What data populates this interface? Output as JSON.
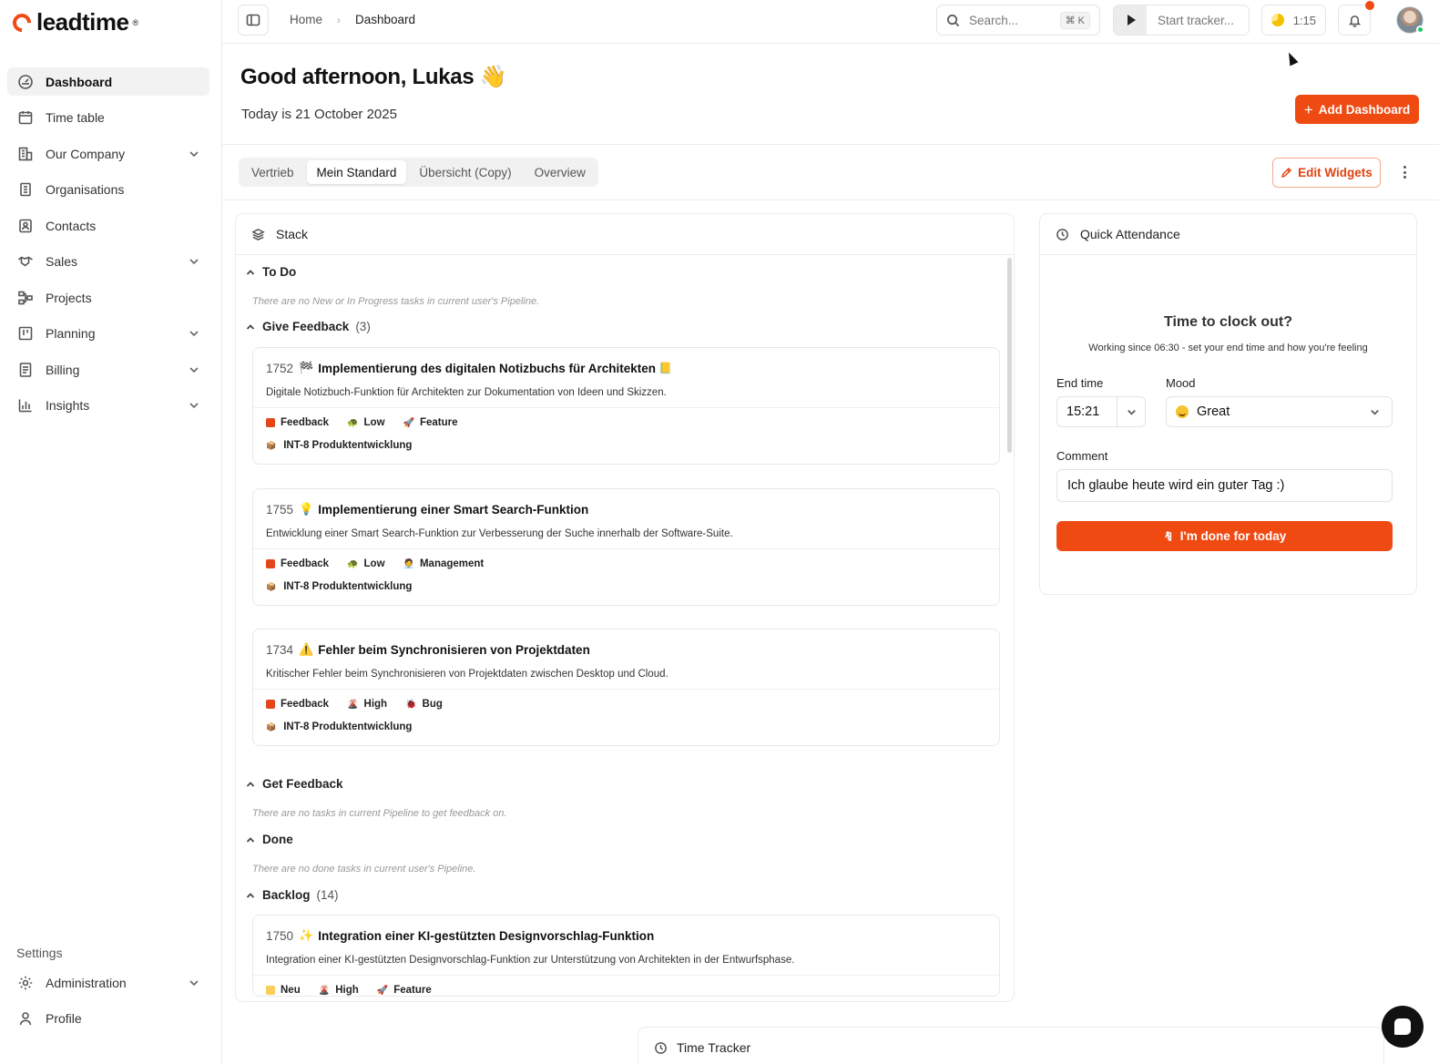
{
  "app": {
    "logo_text": "leadtime"
  },
  "sidebar": {
    "items": [
      {
        "label": "Dashboard",
        "icon": "dashboard-gauge-icon",
        "active": true,
        "expandable": false
      },
      {
        "label": "Time table",
        "icon": "calendar-icon",
        "active": false,
        "expandable": false
      },
      {
        "label": "Our Company",
        "icon": "building-icon",
        "active": false,
        "expandable": true
      },
      {
        "label": "Organisations",
        "icon": "organisation-icon",
        "active": false,
        "expandable": false
      },
      {
        "label": "Contacts",
        "icon": "contact-card-icon",
        "active": false,
        "expandable": false
      },
      {
        "label": "Sales",
        "icon": "handshake-icon",
        "active": false,
        "expandable": true
      },
      {
        "label": "Projects",
        "icon": "project-tree-icon",
        "active": false,
        "expandable": false
      },
      {
        "label": "Planning",
        "icon": "kanban-icon",
        "active": false,
        "expandable": true
      },
      {
        "label": "Billing",
        "icon": "invoice-icon",
        "active": false,
        "expandable": true
      },
      {
        "label": "Insights",
        "icon": "bar-chart-icon",
        "active": false,
        "expandable": true
      }
    ],
    "settings_title": "Settings",
    "bottom_items": [
      {
        "label": "Administration",
        "icon": "gear-icon",
        "expandable": true
      },
      {
        "label": "Profile",
        "icon": "user-icon",
        "expandable": false
      }
    ]
  },
  "topbar": {
    "breadcrumb": {
      "home": "Home",
      "separator": "›",
      "current": "Dashboard"
    },
    "search_placeholder": "Search...",
    "search_shortcut": "⌘ K",
    "tracker_label": "Start tracker...",
    "timer_value": "1:15",
    "notification_dot": true
  },
  "header": {
    "greeting": "Good afternoon, Lukas 👋",
    "date_text": "Today is 21 October 2025",
    "add_dashboard": "Add Dashboard"
  },
  "tabs": {
    "items": [
      "Vertrieb",
      "Mein Standard",
      "Übersicht (Copy)",
      "Overview"
    ],
    "active_index": 1,
    "edit_widgets": "Edit Widgets"
  },
  "stack": {
    "title": "Stack",
    "sections": {
      "todo": {
        "name": "To Do",
        "empty": "There are no New or In Progress tasks in current user's Pipeline."
      },
      "give_feedback": {
        "name": "Give Feedback",
        "count": "(3)"
      },
      "get_feedback": {
        "name": "Get Feedback",
        "empty": "There are no tasks in current Pipeline to get feedback on."
      },
      "done": {
        "name": "Done",
        "empty": "There are no done tasks in current user's Pipeline."
      },
      "backlog": {
        "name": "Backlog",
        "count": "(14)"
      }
    },
    "tasks": [
      {
        "id": "1752",
        "emoji": "🏁",
        "title": "Implementierung des digitalen Notizbuchs für Architekten",
        "trail": "📒",
        "desc": "Digitale Notizbuch-Funktion für Architekten zur Dokumentation von Ideen und Skizzen.",
        "status": "Feedback",
        "status_color": "#e4461b",
        "priority": "Low",
        "priority_emoji": "🐢",
        "type": "Feature",
        "type_emoji": "🚀",
        "project": "INT-8 Produktentwicklung"
      },
      {
        "id": "1755",
        "emoji": "💡",
        "title": "Implementierung einer Smart Search-Funktion",
        "trail": "",
        "desc": "Entwicklung einer Smart Search-Funktion zur Verbesserung der Suche innerhalb der Software-Suite.",
        "status": "Feedback",
        "status_color": "#e4461b",
        "priority": "Low",
        "priority_emoji": "🐢",
        "type": "Management",
        "type_emoji": "🧑‍💼",
        "project": "INT-8 Produktentwicklung"
      },
      {
        "id": "1734",
        "emoji": "⚠️",
        "title": "Fehler beim Synchronisieren von Projektdaten",
        "trail": "",
        "desc": "Kritischer Fehler beim Synchronisieren von Projektdaten zwischen Desktop und Cloud.",
        "status": "Feedback",
        "status_color": "#e4461b",
        "priority": "High",
        "priority_emoji": "🌋",
        "type": "Bug",
        "type_emoji": "🐞",
        "project": "INT-8 Produktentwicklung"
      },
      {
        "id": "1750",
        "emoji": "✨",
        "title": "Integration einer KI-gestützten Designvorschlag-Funktion",
        "trail": "",
        "desc": "Integration einer KI-gestützten Designvorschlag-Funktion zur Unterstützung von Architekten in der Entwurfsphase.",
        "status": "Neu",
        "status_color": "#f7cf5a",
        "priority": "High",
        "priority_emoji": "🌋",
        "type": "Feature",
        "type_emoji": "🚀",
        "project": ""
      }
    ],
    "project_emoji": "📦"
  },
  "attendance": {
    "title": "Quick Attendance",
    "heading": "Time to clock out?",
    "subtitle": "Working since 06:30 - set your end time and how you're feeling",
    "end_time_label": "End time",
    "end_time_value": "15:21",
    "mood_label": "Mood",
    "mood_value": "Great",
    "comment_label": "Comment",
    "comment_value": "Ich glaube heute wird ein guter Tag :)",
    "done_button": "I'm done for today"
  },
  "time_tracker": {
    "title": "Time Tracker"
  },
  "colors": {
    "accent": "#f04a13"
  }
}
